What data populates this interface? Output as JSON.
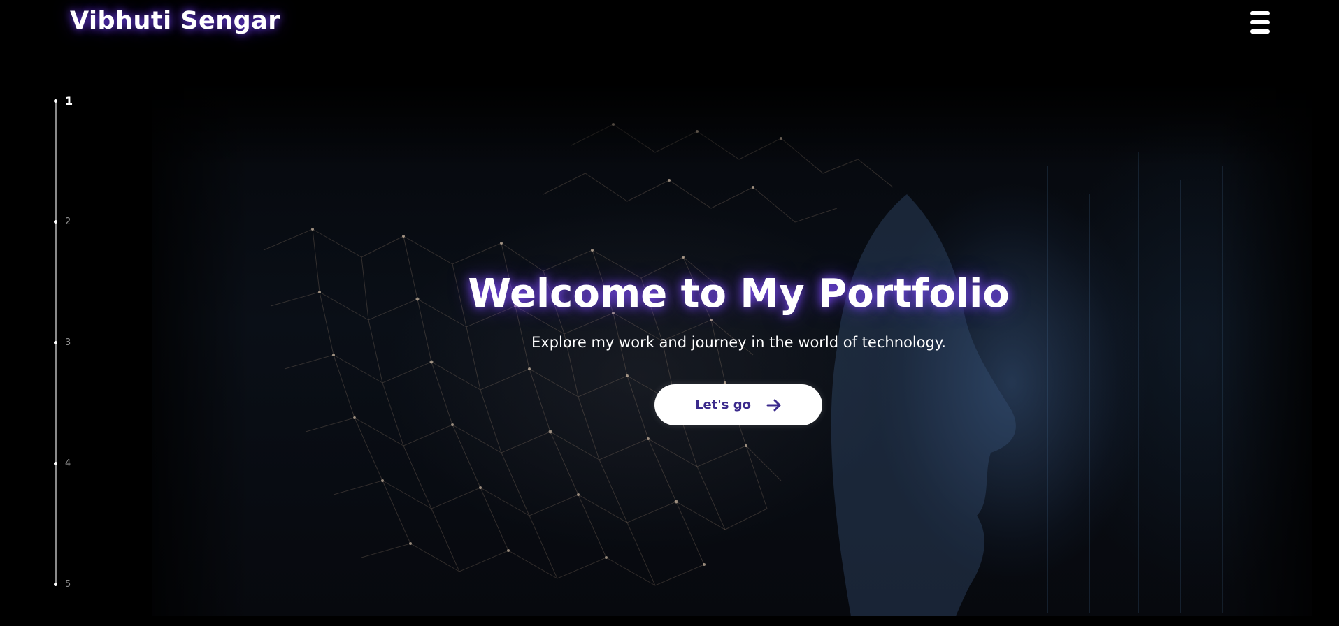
{
  "header": {
    "brand": "Vibhuti Sengar",
    "menu_icon": "hamburger-menu-icon"
  },
  "side_nav": {
    "items": [
      {
        "label": "1",
        "active": true
      },
      {
        "label": "2",
        "active": false
      },
      {
        "label": "3",
        "active": false
      },
      {
        "label": "4",
        "active": false
      },
      {
        "label": "5",
        "active": false
      }
    ]
  },
  "hero": {
    "title": "Welcome to My Portfolio",
    "subtitle": "Explore my work and journey in the world of technology.",
    "cta_label": "Let's go",
    "cta_icon": "arrow-right-icon"
  },
  "colors": {
    "glow": "#7a4dff",
    "cta_text": "#3b2a8c",
    "background": "#000000"
  }
}
